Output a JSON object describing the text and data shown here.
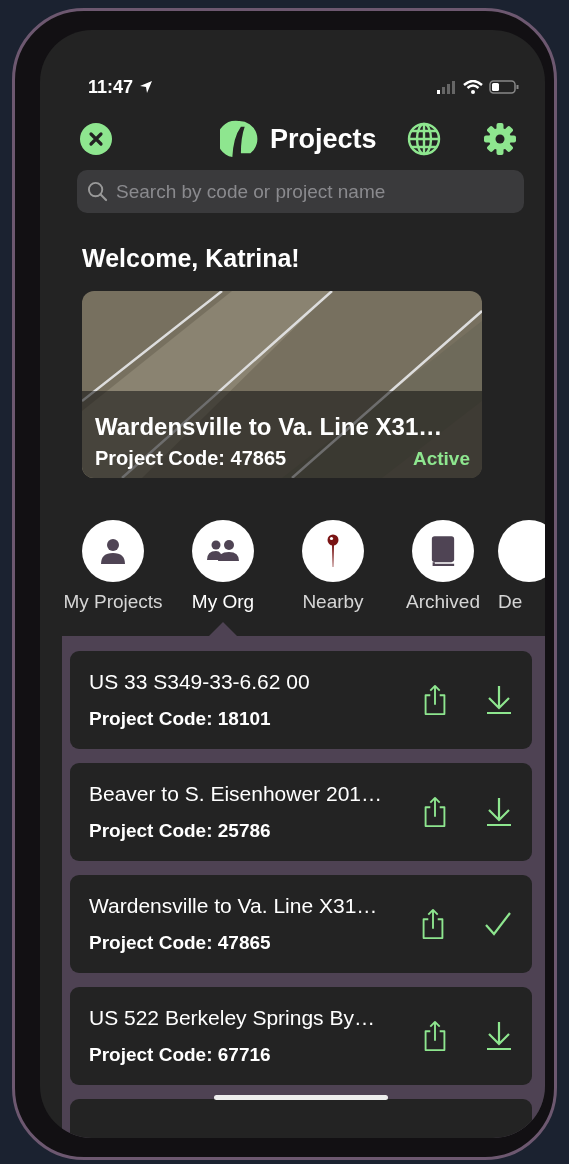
{
  "status_bar": {
    "time": "11:47"
  },
  "header": {
    "title": "Projects"
  },
  "search": {
    "placeholder": "Search by code or project name"
  },
  "welcome": "Welcome, Katrina!",
  "featured": {
    "name": "Wardensville to Va. Line X31…",
    "code": "Project Code: 47865",
    "status": "Active"
  },
  "categories": [
    {
      "label": "My Projects",
      "kind": "person",
      "selected": false
    },
    {
      "label": "My Org",
      "kind": "group",
      "selected": true
    },
    {
      "label": "Nearby",
      "kind": "pin",
      "selected": false
    },
    {
      "label": "Archived",
      "kind": "book",
      "selected": false
    },
    {
      "label": "De",
      "kind": "other",
      "selected": false
    }
  ],
  "projects": [
    {
      "name": "US 33 S349-33-6.62 00",
      "code": "Project Code: 18101",
      "downloaded": false
    },
    {
      "name": "Beaver to S. Eisenhower 201…",
      "code": "Project Code: 25786",
      "downloaded": false
    },
    {
      "name": "Wardensville to Va. Line X31…",
      "code": "Project Code: 47865",
      "downloaded": true
    },
    {
      "name": "US 522 Berkeley Springs By…",
      "code": "Project Code: 67716",
      "downloaded": false
    }
  ]
}
